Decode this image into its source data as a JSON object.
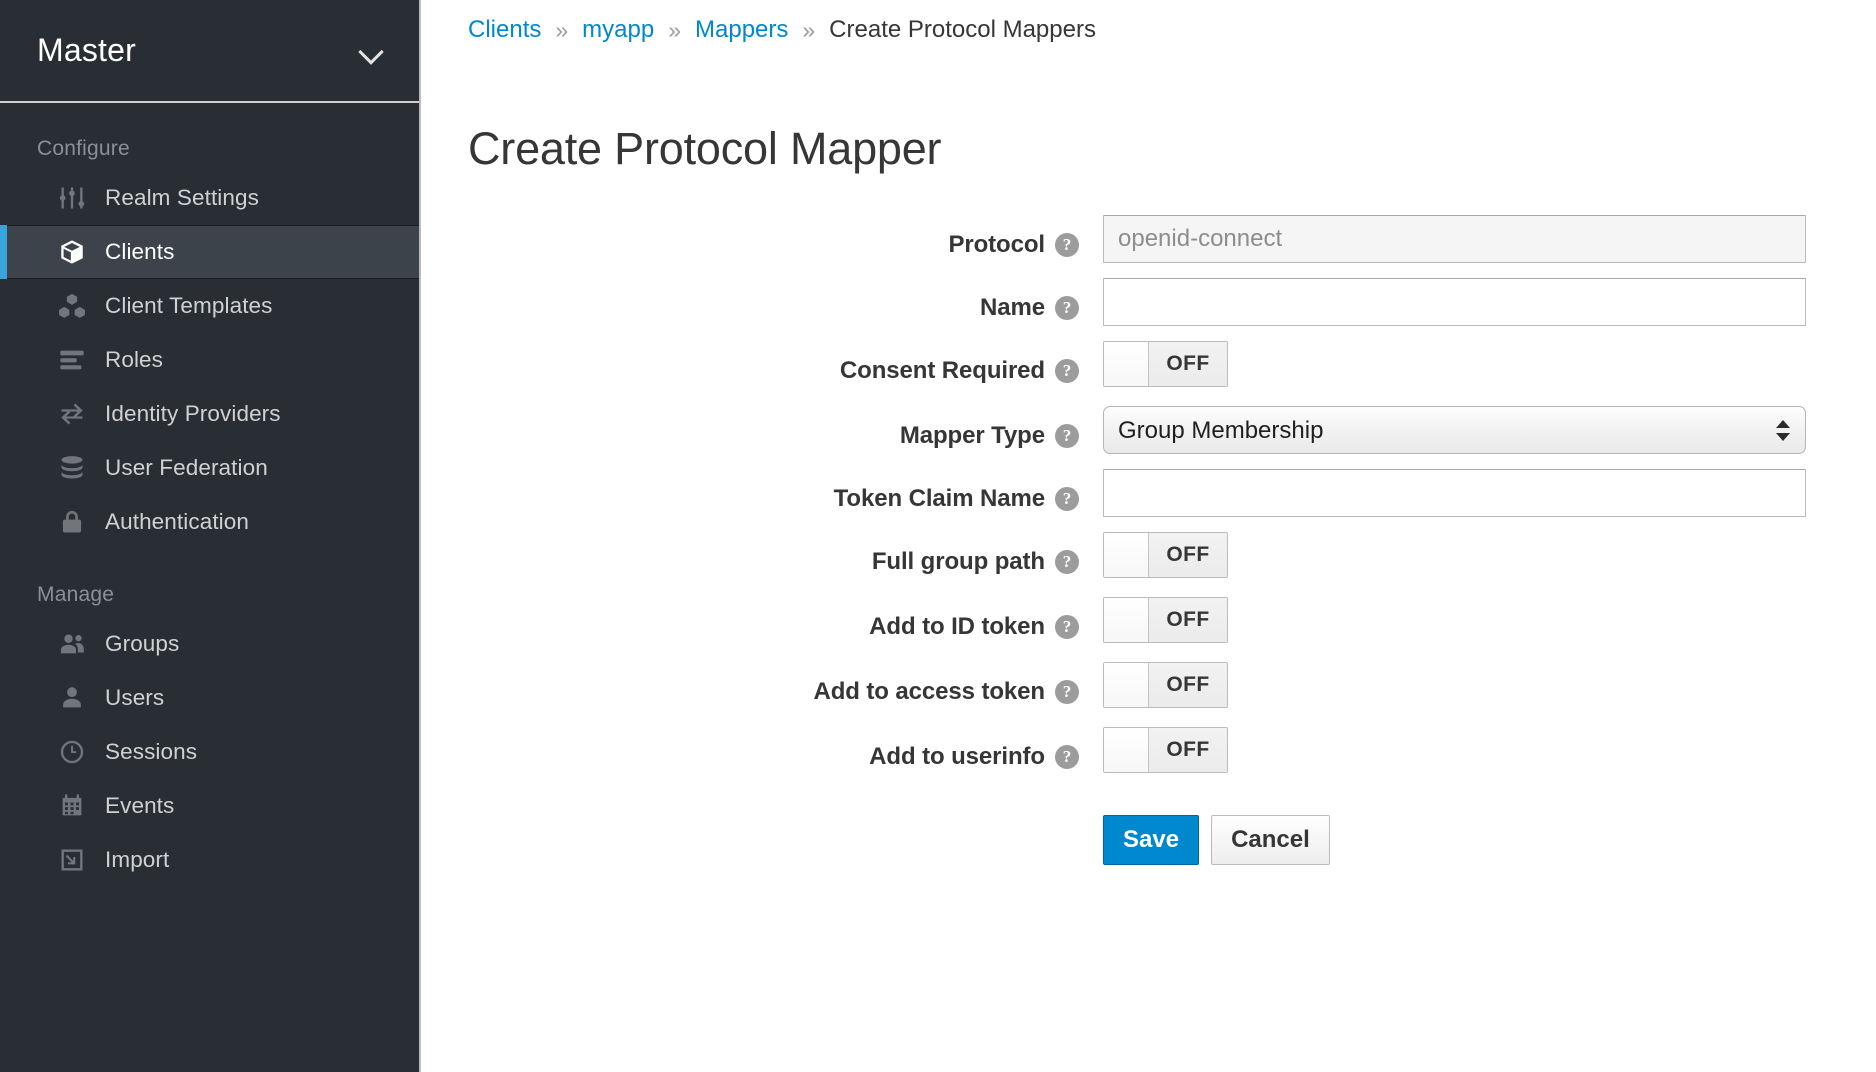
{
  "sidebar": {
    "realm_selector": {
      "label": "Master",
      "caret_icon": "chevron-down-icon"
    },
    "sections": [
      {
        "label": "Configure",
        "items": [
          {
            "label": "Realm Settings",
            "icon": "sliders-icon",
            "active": false
          },
          {
            "label": "Clients",
            "icon": "cube-icon",
            "active": true
          },
          {
            "label": "Client Templates",
            "icon": "cubes-icon",
            "active": false
          },
          {
            "label": "Roles",
            "icon": "list-icon",
            "active": false
          },
          {
            "label": "Identity Providers",
            "icon": "exchange-icon",
            "active": false
          },
          {
            "label": "User Federation",
            "icon": "database-icon",
            "active": false
          },
          {
            "label": "Authentication",
            "icon": "lock-icon",
            "active": false
          }
        ]
      },
      {
        "label": "Manage",
        "items": [
          {
            "label": "Groups",
            "icon": "users-icon",
            "active": false
          },
          {
            "label": "Users",
            "icon": "user-icon",
            "active": false
          },
          {
            "label": "Sessions",
            "icon": "clock-icon",
            "active": false
          },
          {
            "label": "Events",
            "icon": "calendar-icon",
            "active": false
          },
          {
            "label": "Import",
            "icon": "import-arrow-icon",
            "active": false
          }
        ]
      }
    ]
  },
  "breadcrumb": {
    "separator": "»",
    "items": [
      {
        "label": "Clients",
        "link": true
      },
      {
        "label": "myapp",
        "link": true
      },
      {
        "label": "Mappers",
        "link": true
      },
      {
        "label": "Create Protocol Mappers",
        "link": false
      }
    ]
  },
  "page": {
    "title": "Create Protocol Mapper"
  },
  "form": {
    "help_glyph": "?",
    "fields": {
      "protocol": {
        "label": "Protocol",
        "value": "openid-connect",
        "readonly": true
      },
      "name": {
        "label": "Name",
        "value": "",
        "placeholder": ""
      },
      "consent_required": {
        "label": "Consent Required",
        "state": "OFF"
      },
      "mapper_type": {
        "label": "Mapper Type",
        "selected": "Group Membership"
      },
      "token_claim_name": {
        "label": "Token Claim Name",
        "value": "",
        "placeholder": ""
      },
      "full_group_path": {
        "label": "Full group path",
        "state": "OFF"
      },
      "add_to_id_token": {
        "label": "Add to ID token",
        "state": "OFF"
      },
      "add_to_access_token": {
        "label": "Add to access token",
        "state": "OFF"
      },
      "add_to_userinfo": {
        "label": "Add to userinfo",
        "state": "OFF"
      }
    },
    "actions": {
      "save": "Save",
      "cancel": "Cancel"
    }
  },
  "colors": {
    "sidebar_bg": "#292e34",
    "sidebar_active_bg": "#3d434a",
    "accent_blue": "#39a5dc",
    "link_blue": "#0088ce",
    "primary_button": "#0088ce",
    "text_dark": "#363636",
    "muted_text": "#8b9096"
  }
}
